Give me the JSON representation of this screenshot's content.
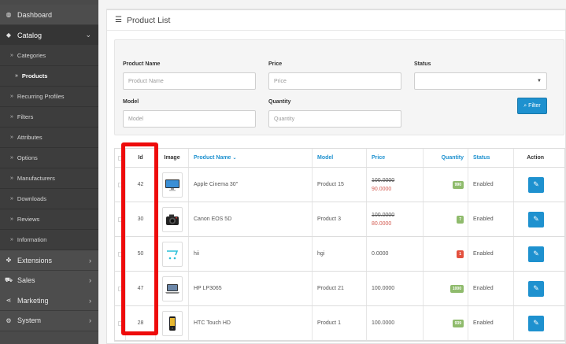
{
  "sidebar": {
    "top": [
      {
        "label": "Dashboard",
        "icon": "dashboard-icon",
        "glyph": "◍"
      },
      {
        "label": "Catalog",
        "icon": "tag-icon",
        "glyph": "◆",
        "expanded": true
      }
    ],
    "catalog_items": [
      {
        "label": "Categories"
      },
      {
        "label": "Products",
        "active": true
      },
      {
        "label": "Recurring Profiles"
      },
      {
        "label": "Filters"
      },
      {
        "label": "Attributes",
        "has_children": true
      },
      {
        "label": "Options"
      },
      {
        "label": "Manufacturers"
      },
      {
        "label": "Downloads"
      },
      {
        "label": "Reviews"
      },
      {
        "label": "Information"
      }
    ],
    "bottom": [
      {
        "label": "Extensions",
        "icon": "puzzle-icon",
        "glyph": "✤"
      },
      {
        "label": "Sales",
        "icon": "cart-icon",
        "glyph": "⛟"
      },
      {
        "label": "Marketing",
        "icon": "share-icon",
        "glyph": "⋖"
      },
      {
        "label": "System",
        "icon": "gear-icon",
        "glyph": "⚙"
      }
    ]
  },
  "panel": {
    "title": "Product List"
  },
  "filter": {
    "product_name_label": "Product Name",
    "product_name_placeholder": "Product Name",
    "price_label": "Price",
    "price_placeholder": "Price",
    "status_label": "Status",
    "status_value": "",
    "model_label": "Model",
    "model_placeholder": "Model",
    "quantity_label": "Quantity",
    "quantity_placeholder": "Quantity",
    "button_label": "Filter"
  },
  "table": {
    "headers": {
      "id": "Id",
      "image": "Image",
      "product_name": "Product Name",
      "model": "Model",
      "price": "Price",
      "quantity": "Quantity",
      "status": "Status",
      "action": "Action"
    },
    "rows": [
      {
        "id": "42",
        "image": "monitor-image",
        "name": "Apple Cinema 30\"",
        "model": "Product 15",
        "price": "100.0000",
        "special": "90.0000",
        "quantity": "990",
        "qty_status": "ok",
        "status": "Enabled"
      },
      {
        "id": "30",
        "image": "camera-image",
        "name": "Canon EOS 5D",
        "model": "Product 3",
        "price": "100.0000",
        "special": "80.0000",
        "quantity": "7",
        "qty_status": "ok",
        "status": "Enabled"
      },
      {
        "id": "50",
        "image": "cart-logo-image",
        "name": "hii",
        "model": "hgi",
        "price": "0.0000",
        "special": "",
        "quantity": "1",
        "qty_status": "low",
        "status": "Enabled"
      },
      {
        "id": "47",
        "image": "laptop-image",
        "name": "HP LP3065",
        "model": "Product 21",
        "price": "100.0000",
        "special": "",
        "quantity": "1000",
        "qty_status": "ok",
        "status": "Enabled"
      },
      {
        "id": "28",
        "image": "phone-image",
        "name": "HTC Touch HD",
        "model": "Product 1",
        "price": "100.0000",
        "special": "",
        "quantity": "939",
        "qty_status": "ok",
        "status": "Enabled"
      }
    ]
  }
}
